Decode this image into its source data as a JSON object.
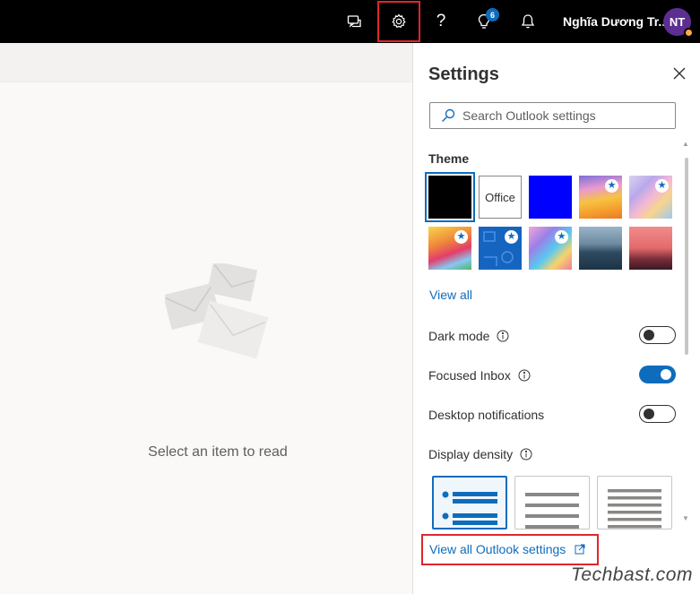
{
  "topbar": {
    "user_name": "Nghĩa Dương Tr..",
    "avatar_initials": "NT",
    "tips_badge": "6",
    "icons": [
      "feedback-icon",
      "gear-icon",
      "help-icon",
      "lightbulb-icon",
      "bell-icon"
    ]
  },
  "reading_pane": {
    "empty_text": "Select an item to read"
  },
  "settings": {
    "title": "Settings",
    "search_placeholder": "Search Outlook settings",
    "theme_label": "Theme",
    "themes": [
      {
        "name": "Black",
        "selected": true,
        "premium": false
      },
      {
        "name": "Office",
        "label": "Office",
        "selected": false,
        "premium": false
      },
      {
        "name": "Blue",
        "selected": false,
        "premium": false
      },
      {
        "name": "Colorful stripes",
        "selected": false,
        "premium": true
      },
      {
        "name": "Rainbow waves",
        "selected": false,
        "premium": true
      },
      {
        "name": "Illustration 1",
        "selected": false,
        "premium": true
      },
      {
        "name": "Blue pattern",
        "selected": false,
        "premium": true
      },
      {
        "name": "Colorful shapes",
        "selected": false,
        "premium": true
      },
      {
        "name": "Mountains",
        "selected": false,
        "premium": false
      },
      {
        "name": "Sunset",
        "selected": false,
        "premium": false
      }
    ],
    "view_all": "View all",
    "dark_mode_label": "Dark mode",
    "dark_mode_on": false,
    "focused_inbox_label": "Focused Inbox",
    "focused_inbox_on": true,
    "desktop_notifications_label": "Desktop notifications",
    "desktop_notifications_on": false,
    "display_density_label": "Display density",
    "view_all_settings": "View all Outlook settings"
  },
  "colors": {
    "accent": "#0f6cbd",
    "highlight_box": "#e0262b",
    "topbar": "#000000"
  },
  "watermark": "Techbast.com"
}
